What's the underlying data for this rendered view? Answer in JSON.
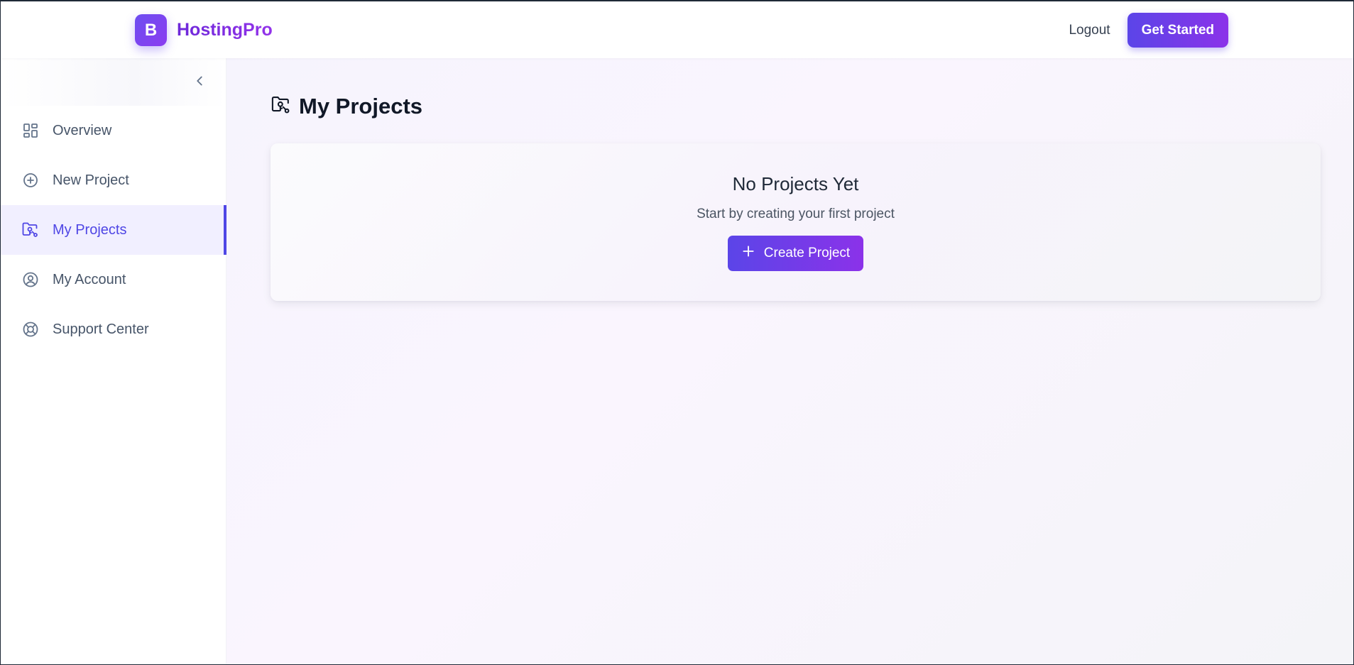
{
  "header": {
    "brand_logo_letter": "B",
    "brand_name": "HostingPro",
    "logout_label": "Logout",
    "cta_label": "Get Started"
  },
  "sidebar": {
    "collapse_icon": "chevron-left-icon",
    "items": [
      {
        "label": "Overview",
        "icon": "grid-icon",
        "active": false
      },
      {
        "label": "New Project",
        "icon": "plus-circle-icon",
        "active": false
      },
      {
        "label": "My Projects",
        "icon": "folder-key-icon",
        "active": true
      },
      {
        "label": "My Account",
        "icon": "user-circle-icon",
        "active": false
      },
      {
        "label": "Support Center",
        "icon": "lifebuoy-icon",
        "active": false
      }
    ]
  },
  "main": {
    "page_title": "My Projects",
    "page_title_icon": "folder-key-icon",
    "empty_state": {
      "title": "No Projects Yet",
      "subtitle": "Start by creating your first project",
      "button_label": "Create Project",
      "button_icon": "plus-icon"
    }
  },
  "colors": {
    "accent": "#4f46e5",
    "gradient_start": "#5b45e8",
    "gradient_end": "#8b32e9",
    "active_nav_bg": "#f1efff"
  }
}
